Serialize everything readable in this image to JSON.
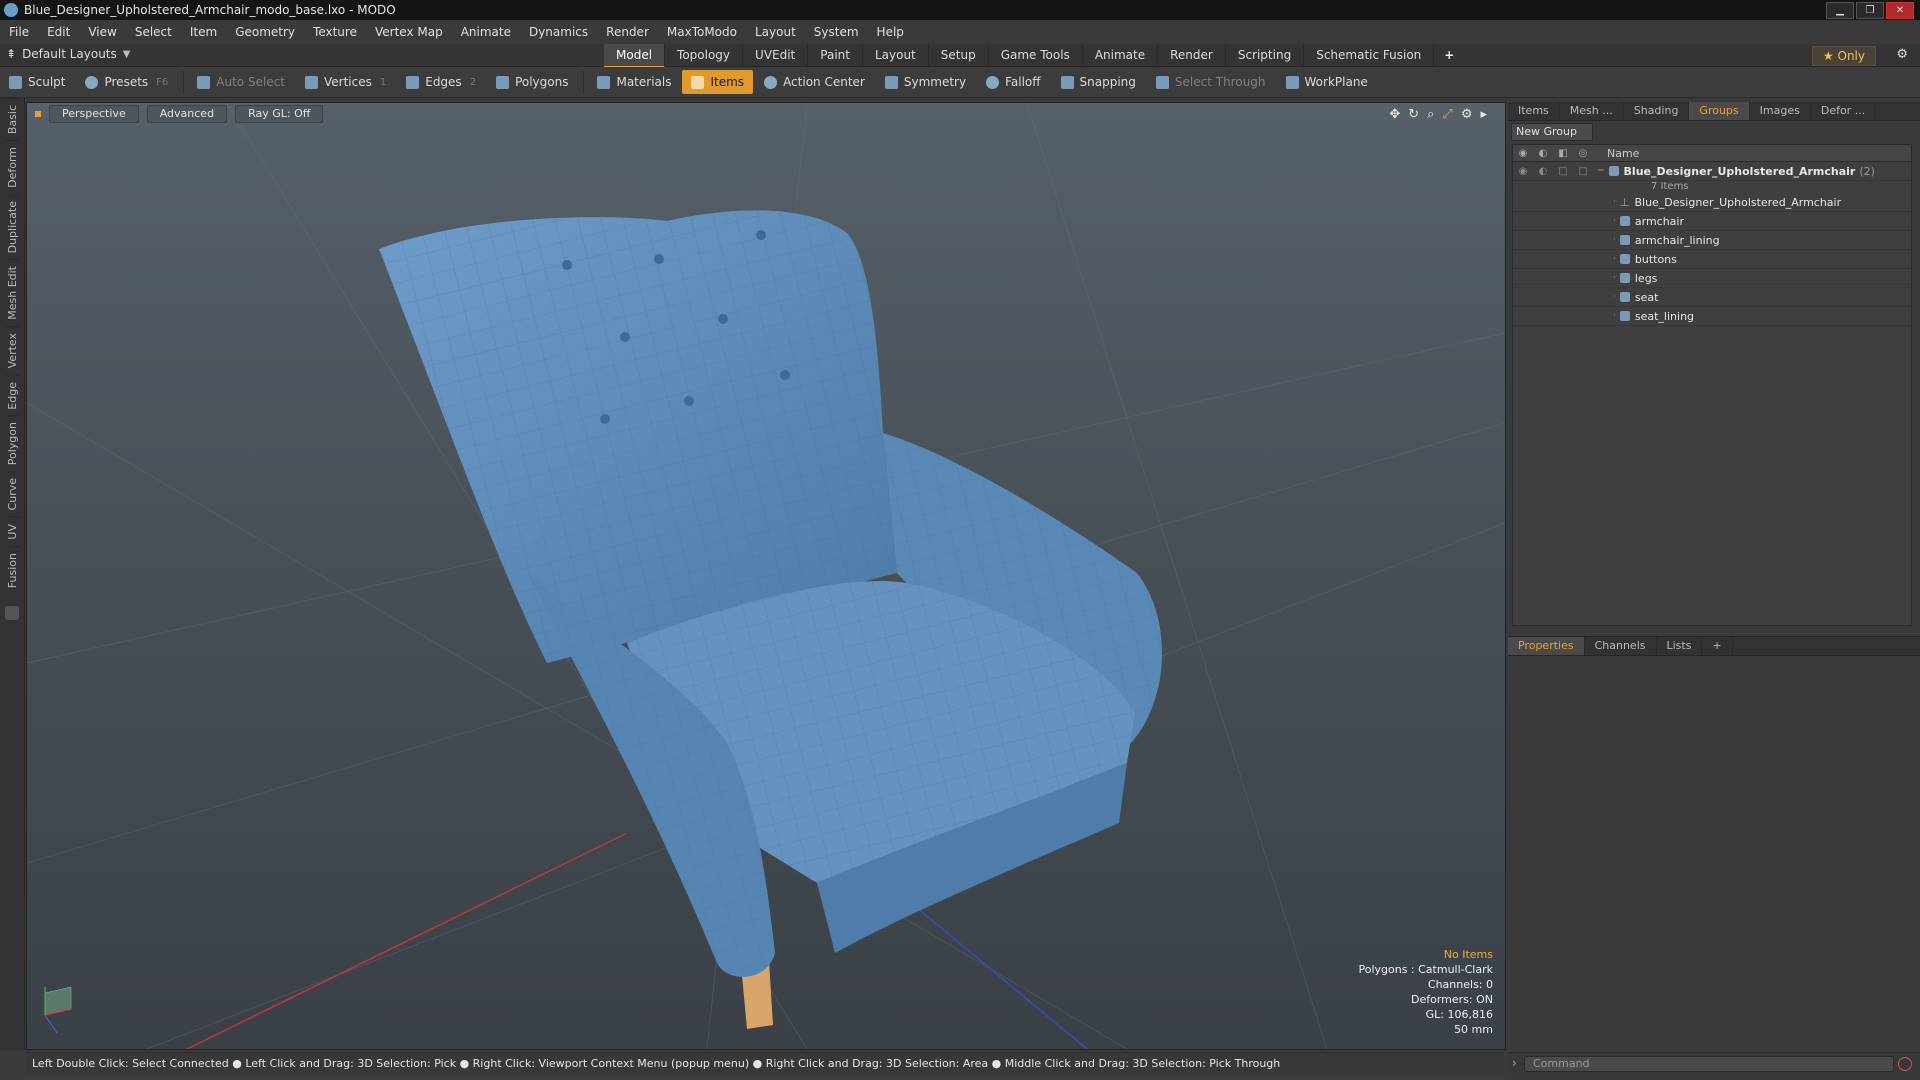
{
  "window": {
    "title": "Blue_Designer_Upholstered_Armchair_modo_base.lxo - MODO"
  },
  "menu": [
    "File",
    "Edit",
    "View",
    "Select",
    "Item",
    "Geometry",
    "Texture",
    "Vertex Map",
    "Animate",
    "Dynamics",
    "Render",
    "MaxToModo",
    "Layout",
    "System",
    "Help"
  ],
  "layout": {
    "default_layouts": "Default Layouts",
    "tabs": [
      "Model",
      "Topology",
      "UVEdit",
      "Paint",
      "Layout",
      "Setup",
      "Game Tools",
      "Animate",
      "Render",
      "Scripting",
      "Schematic Fusion"
    ],
    "active_tab": "Model",
    "only_label": "Only"
  },
  "toolbar": {
    "sculpt": "Sculpt",
    "presets": "Presets",
    "presets_key": "F6",
    "auto_select": "Auto Select",
    "vertices": "Vertices",
    "vertices_key": "1",
    "edges": "Edges",
    "edges_key": "2",
    "polygons": "Polygons",
    "materials": "Materials",
    "items": "Items",
    "action_center": "Action Center",
    "symmetry": "Symmetry",
    "falloff": "Falloff",
    "snapping": "Snapping",
    "select_through": "Select Through",
    "workplane": "WorkPlane"
  },
  "left_tabs": [
    "Basic",
    "Deform",
    "Duplicate",
    "Mesh Edit",
    "Vertex",
    "Edge",
    "Polygon",
    "Curve",
    "UV",
    "Fusion"
  ],
  "viewport": {
    "view": "Perspective",
    "advanced": "Advanced",
    "raygl": "Ray GL: Off",
    "info": {
      "no_items": "No Items",
      "polygons": "Polygons : Catmull-Clark",
      "channels": "Channels: 0",
      "deformers": "Deformers: ON",
      "gl": "GL: 106,816",
      "scale": "50 mm"
    }
  },
  "status": "Left Double Click: Select Connected ● Left Click and Drag: 3D Selection: Pick ● Right Click: Viewport Context Menu (popup menu) ● Right Click and Drag: 3D Selection: Area ● Middle Click and Drag: 3D Selection: Pick Through",
  "groups_panel": {
    "tabs": [
      "Items",
      "Mesh ...",
      "Shading",
      "Groups",
      "Images",
      "Defor ..."
    ],
    "active_tab": "Groups",
    "new_group": "New Group",
    "name_col": "Name",
    "group": {
      "name": "Blue_Designer_Upholstered_Armchair",
      "count": "(2)",
      "sub": "7 Items"
    },
    "children": [
      "Blue_Designer_Upholstered_Armchair",
      "armchair",
      "armchair_lining",
      "buttons",
      "legs",
      "seat",
      "seat_lining"
    ]
  },
  "properties_panel": {
    "tabs": [
      "Properties",
      "Channels",
      "Lists"
    ],
    "active_tab": "Properties"
  },
  "command": {
    "placeholder": "Command"
  },
  "colors": {
    "accent": "#e09a2e",
    "chair": "#5d8bb8",
    "legs": "#d8a56a"
  }
}
